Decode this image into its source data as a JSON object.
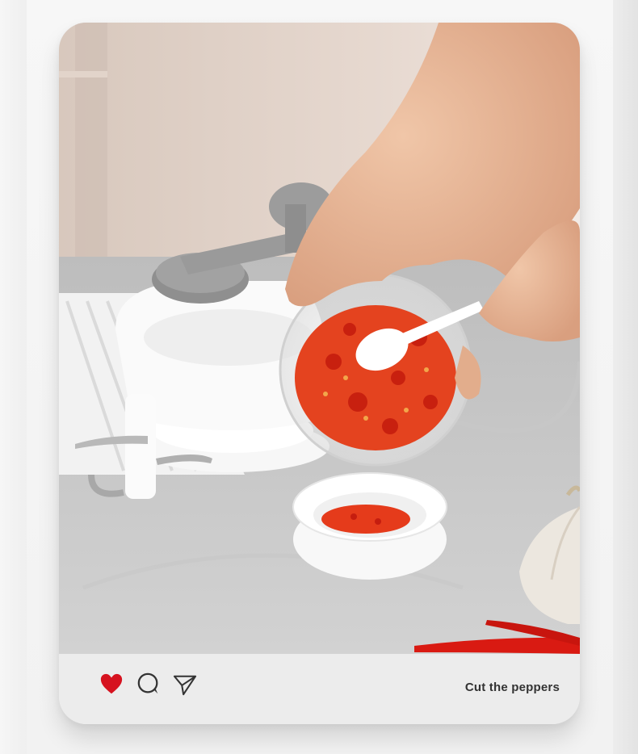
{
  "post": {
    "caption": "Cut the peppers"
  },
  "actions": {
    "like_icon": "heart-icon",
    "comment_icon": "comment-icon",
    "share_icon": "send-icon",
    "like_color": "#d6121f",
    "icon_color": "#333333"
  }
}
